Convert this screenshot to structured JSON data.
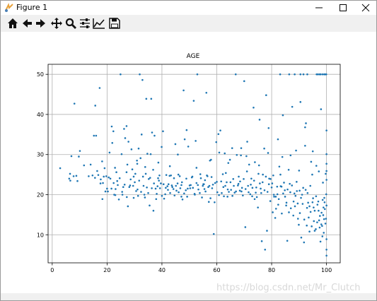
{
  "window": {
    "title": "Figure 1",
    "controls": [
      "minimize-icon",
      "maximize-icon",
      "close-icon"
    ]
  },
  "toolbar": {
    "buttons": [
      {
        "name": "home-icon"
      },
      {
        "name": "back-arrow-icon"
      },
      {
        "name": "forward-arrow-icon"
      },
      {
        "name": "pan-icon"
      },
      {
        "name": "zoom-icon"
      },
      {
        "name": "configure-subplots-icon"
      },
      {
        "name": "edit-axis-icon"
      },
      {
        "name": "save-icon"
      }
    ]
  },
  "watermark": "https://blog.csdn.net/Mr_Clutch",
  "chart_data": {
    "type": "scatter",
    "title": "AGE",
    "xlabel": "",
    "ylabel": "",
    "xlim": [
      -1.5,
      105
    ],
    "ylim": [
      3,
      52.5
    ],
    "xticks": [
      0,
      20,
      40,
      60,
      80,
      100
    ],
    "yticks": [
      10,
      20,
      30,
      40,
      50
    ],
    "grid": true,
    "color": "#1f77b4",
    "points": [
      [
        2.9,
        26.6
      ],
      [
        6.2,
        24.0
      ],
      [
        6.5,
        25.2
      ],
      [
        6.6,
        23.5
      ],
      [
        7.0,
        29.6
      ],
      [
        7.8,
        24.6
      ],
      [
        8.1,
        42.7
      ],
      [
        8.8,
        24.7
      ],
      [
        9.2,
        23.4
      ],
      [
        9.7,
        29.5
      ],
      [
        10.1,
        30.9
      ],
      [
        13.3,
        24.6
      ],
      [
        14.0,
        27.5
      ],
      [
        14.7,
        24.8
      ],
      [
        15.2,
        34.7
      ],
      [
        15.7,
        42.2
      ],
      [
        16.0,
        34.7
      ],
      [
        16.4,
        25.9
      ],
      [
        17.3,
        46.6
      ],
      [
        17.6,
        22.8
      ],
      [
        18.3,
        18.9
      ],
      [
        18.8,
        24.5
      ],
      [
        19.1,
        26.6
      ],
      [
        20.0,
        21.5
      ],
      [
        20.3,
        20.8
      ],
      [
        20.9,
        30.5
      ],
      [
        21.2,
        24.0
      ],
      [
        21.7,
        37.0
      ],
      [
        21.9,
        32.9
      ],
      [
        22.3,
        35.8
      ],
      [
        22.6,
        20.0
      ],
      [
        23.4,
        25.6
      ],
      [
        23.7,
        23.4
      ],
      [
        24.3,
        18.8
      ],
      [
        24.9,
        50.0
      ],
      [
        25.3,
        30.1
      ],
      [
        25.6,
        20.0
      ],
      [
        26.2,
        36.4
      ],
      [
        26.6,
        34.1
      ],
      [
        27.1,
        37.1
      ],
      [
        27.4,
        27.5
      ],
      [
        27.8,
        33.2
      ],
      [
        27.6,
        17.1
      ],
      [
        28.4,
        22.3
      ],
      [
        28.9,
        31.3
      ],
      [
        29.2,
        26.3
      ],
      [
        29.7,
        19.2
      ],
      [
        30.3,
        25.2
      ],
      [
        30.9,
        28.5
      ],
      [
        31.1,
        21.3
      ],
      [
        31.5,
        31.5
      ],
      [
        31.9,
        50.0
      ],
      [
        32.2,
        29.1
      ],
      [
        32.6,
        35.0
      ],
      [
        32.9,
        48.6
      ],
      [
        33.3,
        22.2
      ],
      [
        33.6,
        20.0
      ],
      [
        34.1,
        25.2
      ],
      [
        34.3,
        43.9
      ],
      [
        34.7,
        30.2
      ],
      [
        35.2,
        23.9
      ],
      [
        35.5,
        17.3
      ],
      [
        35.9,
        30.1
      ],
      [
        36.1,
        43.9
      ],
      [
        36.4,
        35.5
      ],
      [
        36.9,
        16.0
      ],
      [
        37.3,
        34.7
      ],
      [
        37.7,
        21.5
      ],
      [
        38.1,
        20.2
      ],
      [
        38.6,
        24.1
      ],
      [
        38.9,
        23.5
      ],
      [
        39.3,
        21.6
      ],
      [
        39.6,
        22.8
      ],
      [
        39.9,
        31.9
      ],
      [
        40.4,
        35.8
      ],
      [
        40.8,
        19.0
      ],
      [
        41.2,
        20.1
      ],
      [
        41.6,
        24.9
      ],
      [
        42.2,
        21.2
      ],
      [
        42.4,
        22.6
      ],
      [
        42.9,
        27.1
      ],
      [
        43.3,
        24.8
      ],
      [
        43.6,
        22.3
      ],
      [
        44.2,
        21.4
      ],
      [
        44.6,
        19.8
      ],
      [
        44.9,
        32.6
      ],
      [
        45.3,
        21.0
      ],
      [
        45.7,
        22.8
      ],
      [
        46.1,
        20.6
      ],
      [
        46.5,
        24.6
      ],
      [
        47.1,
        19.5
      ],
      [
        47.5,
        18.8
      ],
      [
        47.9,
        46.0
      ],
      [
        48.3,
        33.8
      ],
      [
        48.7,
        21.1
      ],
      [
        49.2,
        19.5
      ],
      [
        49.6,
        32.0
      ],
      [
        50.1,
        22.3
      ],
      [
        50.5,
        22.4
      ],
      [
        50.9,
        24.3
      ],
      [
        51.3,
        21.7
      ],
      [
        51.6,
        43.4
      ],
      [
        52.0,
        20.0
      ],
      [
        52.3,
        33.4
      ],
      [
        52.6,
        22.9
      ],
      [
        52.9,
        50.0
      ],
      [
        53.3,
        21.3
      ],
      [
        53.8,
        20.4
      ],
      [
        54.2,
        24.1
      ],
      [
        54.6,
        19.3
      ],
      [
        55.1,
        22.6
      ],
      [
        55.5,
        21.4
      ],
      [
        55.9,
        20.8
      ],
      [
        56.2,
        45.4
      ],
      [
        56.6,
        24.6
      ],
      [
        57.1,
        18.2
      ],
      [
        57.5,
        28.5
      ],
      [
        57.9,
        28.7
      ],
      [
        58.3,
        21.6
      ],
      [
        58.6,
        22.5
      ],
      [
        58.9,
        10.2
      ],
      [
        59.4,
        22.9
      ],
      [
        59.8,
        33.1
      ],
      [
        60.2,
        20.6
      ],
      [
        60.6,
        35.1
      ],
      [
        60.9,
        30.5
      ],
      [
        61.3,
        36.0
      ],
      [
        61.8,
        20.4
      ],
      [
        62.2,
        25.1
      ],
      [
        62.6,
        19.6
      ],
      [
        63.1,
        22.2
      ],
      [
        63.6,
        23.1
      ],
      [
        63.9,
        19.5
      ],
      [
        64.4,
        20.7
      ],
      [
        64.8,
        28.7
      ],
      [
        65.2,
        21.2
      ],
      [
        65.6,
        31.6
      ],
      [
        66.0,
        23.9
      ],
      [
        66.5,
        20.5
      ],
      [
        66.9,
        50.0
      ],
      [
        67.3,
        29.9
      ],
      [
        67.7,
        22.3
      ],
      [
        68.0,
        24.5
      ],
      [
        68.4,
        21.0
      ],
      [
        68.8,
        29.8
      ],
      [
        69.2,
        21.7
      ],
      [
        69.5,
        19.8
      ],
      [
        70.0,
        48.3
      ],
      [
        70.4,
        11.9
      ],
      [
        70.8,
        29.6
      ],
      [
        71.1,
        33.2
      ],
      [
        71.4,
        22.2
      ],
      [
        71.8,
        27.5
      ],
      [
        72.2,
        20.1
      ],
      [
        72.6,
        24.0
      ],
      [
        73.0,
        21.7
      ],
      [
        73.4,
        41.7
      ],
      [
        73.8,
        18.9
      ],
      [
        74.2,
        20.5
      ],
      [
        74.6,
        19.4
      ],
      [
        75.0,
        16.8
      ],
      [
        75.6,
        38.7
      ],
      [
        76.0,
        21.5
      ],
      [
        76.4,
        8.4
      ],
      [
        76.8,
        25.0
      ],
      [
        77.3,
        31.5
      ],
      [
        77.6,
        6.3
      ],
      [
        78.0,
        44.8
      ],
      [
        78.3,
        11.0
      ],
      [
        78.7,
        30.4
      ],
      [
        79.1,
        24.0
      ],
      [
        79.6,
        23.9
      ],
      [
        80.0,
        21.8
      ],
      [
        80.4,
        15.6
      ],
      [
        80.9,
        19.5
      ],
      [
        81.3,
        14.2
      ],
      [
        81.6,
        16.5
      ],
      [
        82.1,
        20.1
      ],
      [
        82.4,
        17.5
      ],
      [
        82.8,
        27.0
      ],
      [
        83.2,
        25.0
      ],
      [
        83.6,
        22.0
      ],
      [
        84.1,
        39.8
      ],
      [
        84.5,
        23.0
      ],
      [
        84.9,
        19.5
      ],
      [
        85.3,
        17.3
      ],
      [
        85.7,
        8.5
      ],
      [
        86.2,
        26.2
      ],
      [
        86.6,
        22.7
      ],
      [
        87.0,
        16.6
      ],
      [
        87.5,
        41.9
      ],
      [
        87.9,
        14.8
      ],
      [
        88.3,
        20.3
      ],
      [
        88.7,
        19.7
      ],
      [
        89.1,
        23.2
      ],
      [
        89.5,
        17.8
      ],
      [
        89.9,
        12.5
      ],
      [
        90.3,
        15.4
      ],
      [
        90.5,
        43.1
      ],
      [
        90.8,
        9.3
      ],
      [
        91.1,
        20.0
      ],
      [
        91.5,
        21.7
      ],
      [
        91.8,
        8.1
      ],
      [
        92.2,
        36.8
      ],
      [
        92.5,
        37.8
      ],
      [
        92.8,
        12.3
      ],
      [
        93.1,
        20.4
      ],
      [
        93.5,
        14.3
      ],
      [
        93.8,
        10.8
      ],
      [
        94.1,
        22.2
      ],
      [
        94.4,
        28.2
      ],
      [
        94.8,
        25.0
      ],
      [
        95.1,
        19.1
      ],
      [
        95.4,
        13.4
      ],
      [
        95.7,
        16.0
      ],
      [
        96.1,
        11.4
      ],
      [
        96.4,
        50.0
      ],
      [
        96.7,
        17.5
      ],
      [
        97.0,
        18.3
      ],
      [
        97.3,
        13.6
      ],
      [
        97.5,
        11.8
      ],
      [
        97.8,
        8.3
      ],
      [
        98.0,
        41.3
      ],
      [
        98.2,
        15.5
      ],
      [
        98.4,
        12.2
      ],
      [
        98.6,
        18.7
      ],
      [
        98.8,
        14.9
      ],
      [
        99.0,
        10.5
      ],
      [
        99.2,
        19.2
      ],
      [
        99.4,
        16.4
      ],
      [
        99.6,
        12.8
      ],
      [
        99.8,
        14.0
      ],
      [
        99.9,
        20.1
      ],
      [
        100.0,
        17.3
      ],
      [
        100.0,
        8.9
      ],
      [
        100.0,
        23.7
      ],
      [
        100.0,
        6.3
      ],
      [
        100.0,
        4.8
      ],
      [
        100.0,
        36.0
      ],
      [
        100.0,
        25.9
      ],
      [
        100.0,
        27.7
      ],
      [
        100.0,
        30.1
      ],
      [
        99.9,
        50.0
      ],
      [
        99.5,
        50.0
      ],
      [
        99.2,
        50.0
      ],
      [
        98.6,
        50.0
      ],
      [
        97.9,
        50.0
      ],
      [
        97.5,
        50.0
      ],
      [
        96.9,
        50.0
      ],
      [
        93.0,
        50.0
      ],
      [
        91.6,
        50.0
      ],
      [
        90.5,
        50.0
      ],
      [
        88.4,
        50.0
      ],
      [
        86.4,
        50.0
      ],
      [
        83.1,
        50.0
      ],
      [
        57.3,
        22.2
      ],
      [
        49.0,
        36.1
      ],
      [
        45.8,
        30.0
      ],
      [
        38.7,
        28.0
      ],
      [
        31.0,
        27.7
      ],
      [
        27.1,
        25.6
      ],
      [
        22.9,
        26.7
      ],
      [
        18.2,
        28.3
      ],
      [
        64.2,
        27.9
      ],
      [
        75.4,
        27.3
      ],
      [
        80.6,
        24.8
      ],
      [
        83.9,
        29.4
      ],
      [
        88.9,
        31.0
      ],
      [
        92.2,
        32.2
      ],
      [
        95.0,
        30.8
      ],
      [
        96.3,
        27.2
      ],
      [
        97.2,
        25.8
      ],
      [
        98.7,
        23.0
      ],
      [
        99.7,
        25.2
      ],
      [
        90.0,
        26.0
      ],
      [
        86.9,
        29.8
      ],
      [
        82.3,
        33.8
      ],
      [
        78.9,
        36.6
      ],
      [
        73.9,
        28.1
      ],
      [
        68.9,
        31.6
      ],
      [
        62.9,
        30.3
      ],
      [
        55.3,
        22.6
      ],
      [
        52.6,
        26.7
      ],
      [
        47.1,
        22.4
      ],
      [
        42.8,
        24.7
      ],
      [
        36.8,
        26.2
      ],
      [
        33.9,
        26.9
      ],
      [
        29.7,
        24.5
      ],
      [
        25.9,
        21.9
      ],
      [
        23.1,
        21.4
      ],
      [
        19.7,
        24.6
      ],
      [
        15.6,
        24.2
      ],
      [
        11.6,
        27.3
      ],
      [
        99.3,
        18.1
      ],
      [
        99.1,
        13.9
      ],
      [
        98.9,
        16.8
      ],
      [
        98.5,
        9.6
      ],
      [
        98.1,
        12.6
      ],
      [
        97.6,
        14.7
      ],
      [
        97.1,
        16.0
      ],
      [
        96.6,
        13.1
      ],
      [
        96.2,
        19.6
      ],
      [
        95.7,
        11.0
      ],
      [
        95.3,
        16.8
      ],
      [
        94.9,
        18.1
      ],
      [
        94.6,
        12.1
      ],
      [
        94.2,
        15.7
      ],
      [
        93.8,
        17.1
      ],
      [
        93.3,
        18.0
      ],
      [
        92.9,
        16.7
      ],
      [
        92.4,
        21.2
      ],
      [
        91.9,
        13.8
      ],
      [
        91.3,
        17.7
      ],
      [
        90.7,
        19.2
      ],
      [
        90.2,
        21.0
      ],
      [
        89.6,
        14.0
      ],
      [
        89.2,
        20.9
      ],
      [
        88.5,
        17.1
      ],
      [
        88.0,
        18.3
      ],
      [
        87.4,
        22.3
      ],
      [
        86.8,
        20.6
      ],
      [
        86.3,
        15.6
      ],
      [
        85.8,
        21.3
      ],
      [
        85.4,
        18.0
      ],
      [
        84.8,
        21.1
      ],
      [
        84.2,
        20.3
      ],
      [
        83.7,
        15.3
      ],
      [
        83.3,
        22.1
      ],
      [
        82.6,
        18.9
      ],
      [
        82.0,
        22.0
      ],
      [
        81.5,
        19.5
      ],
      [
        80.8,
        20.0
      ],
      [
        80.2,
        22.8
      ],
      [
        79.5,
        18.4
      ],
      [
        79.0,
        22.6
      ],
      [
        78.5,
        20.7
      ],
      [
        77.9,
        24.5
      ],
      [
        77.4,
        21.1
      ],
      [
        76.7,
        23.1
      ],
      [
        76.2,
        20.4
      ],
      [
        75.7,
        22.8
      ],
      [
        75.2,
        25.2
      ],
      [
        74.4,
        21.8
      ],
      [
        73.6,
        23.5
      ],
      [
        72.9,
        19.6
      ],
      [
        72.4,
        22.5
      ],
      [
        71.6,
        20.6
      ],
      [
        71.0,
        25.8
      ],
      [
        70.5,
        21.4
      ],
      [
        69.8,
        23.9
      ],
      [
        69.0,
        20.8
      ],
      [
        68.5,
        23.3
      ],
      [
        67.9,
        22.7
      ],
      [
        67.0,
        20.8
      ],
      [
        66.2,
        22.2
      ],
      [
        65.7,
        19.7
      ],
      [
        65.0,
        23.1
      ],
      [
        64.0,
        21.3
      ],
      [
        63.3,
        25.4
      ],
      [
        62.4,
        21.9
      ],
      [
        61.6,
        23.3
      ],
      [
        60.8,
        19.9
      ],
      [
        60.0,
        23.2
      ],
      [
        59.2,
        18.1
      ],
      [
        58.1,
        24.4
      ],
      [
        57.7,
        19.1
      ],
      [
        56.9,
        21.9
      ],
      [
        56.4,
        24.8
      ],
      [
        55.7,
        23.6
      ],
      [
        54.9,
        22.2
      ],
      [
        54.0,
        25.1
      ],
      [
        53.1,
        22.4
      ],
      [
        51.9,
        20.2
      ],
      [
        51.1,
        24.5
      ],
      [
        50.3,
        21.6
      ],
      [
        49.4,
        21.5
      ],
      [
        48.9,
        24.0
      ],
      [
        48.1,
        20.3
      ],
      [
        47.3,
        23.1
      ],
      [
        46.7,
        21.6
      ],
      [
        46.0,
        25.0
      ],
      [
        45.1,
        22.2
      ],
      [
        44.4,
        24.1
      ],
      [
        43.8,
        21.9
      ],
      [
        43.0,
        20.4
      ],
      [
        42.0,
        22.1
      ],
      [
        41.4,
        21.7
      ],
      [
        40.6,
        22.6
      ],
      [
        40.0,
        19.7
      ],
      [
        39.1,
        24.8
      ],
      [
        38.4,
        22.1
      ],
      [
        37.9,
        18.9
      ],
      [
        37.1,
        22.8
      ],
      [
        36.3,
        21.6
      ],
      [
        35.7,
        24.2
      ],
      [
        35.0,
        20.4
      ],
      [
        34.5,
        21.8
      ],
      [
        33.8,
        19.3
      ],
      [
        33.1,
        24.5
      ],
      [
        32.4,
        20.7
      ],
      [
        31.7,
        23.5
      ],
      [
        31.3,
        19.7
      ],
      [
        30.6,
        20.9
      ],
      [
        30.1,
        23.1
      ],
      [
        29.5,
        22.2
      ],
      [
        28.6,
        23.8
      ],
      [
        28.1,
        21.9
      ],
      [
        27.2,
        19.4
      ],
      [
        26.4,
        22.5
      ],
      [
        25.5,
        20.7
      ],
      [
        24.6,
        24.1
      ],
      [
        23.9,
        22.4
      ],
      [
        23.0,
        19.9
      ],
      [
        22.4,
        22.9
      ],
      [
        21.6,
        21.5
      ],
      [
        20.6,
        24.3
      ],
      [
        19.4,
        20.8
      ],
      [
        18.5,
        22.9
      ],
      [
        17.7,
        23.8
      ],
      [
        16.8,
        24.9
      ]
    ]
  }
}
